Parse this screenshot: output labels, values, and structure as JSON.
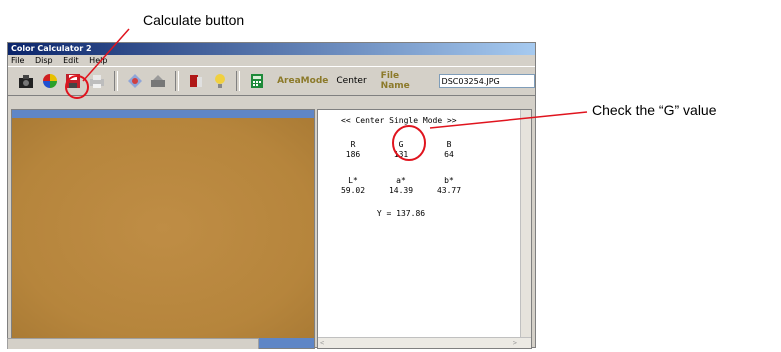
{
  "callouts": {
    "calculate": "Calculate button",
    "g_value": "Check the “G” value"
  },
  "window": {
    "title": "Color Calculator 2",
    "menu": [
      "File",
      "Disp",
      "Edit",
      "Help"
    ]
  },
  "toolbar": {
    "buttons": [
      {
        "name": "camera-icon"
      },
      {
        "name": "color-wheel-icon"
      },
      {
        "name": "save-icon"
      },
      {
        "name": "print-icon"
      },
      {
        "name": "target-icon"
      },
      {
        "name": "scanner-icon"
      },
      {
        "name": "book-icon"
      },
      {
        "name": "lightbulb-icon"
      },
      {
        "name": "calculator-icon"
      }
    ],
    "area_mode_label": "AreaMode",
    "area_mode_value": "Center",
    "file_name_label": "File Name",
    "file_name_value": "DSC03254.JPG"
  },
  "results": {
    "mode_title": "<< Center Single Mode >>",
    "rgb_labels": [
      "R",
      "G",
      "B"
    ],
    "rgb_values": [
      "186",
      "131",
      "64"
    ],
    "lab_labels": [
      "L*",
      "a*",
      "b*"
    ],
    "lab_values": [
      "59.02",
      "14.39",
      "43.77"
    ],
    "y_line": "Y = 137.86"
  },
  "colors": {
    "image_fill": "#b6853c",
    "image_border": "#5f86c6",
    "highlight_circle": "#e0141e"
  }
}
